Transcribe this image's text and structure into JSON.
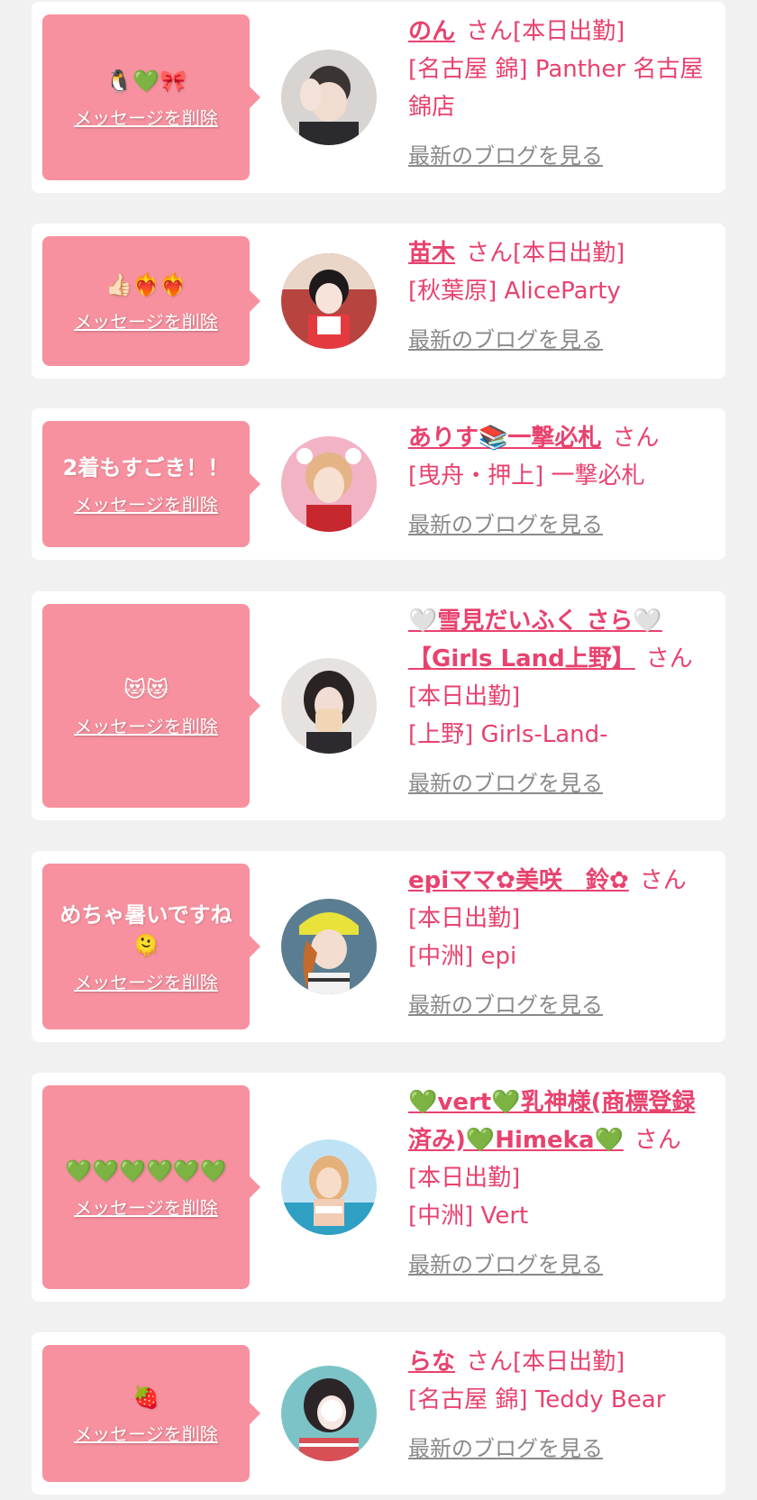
{
  "common": {
    "delete_label": "メッセージを削除",
    "blog_label": "最新のブログを見る",
    "san": "さん"
  },
  "cards": [
    {
      "message": "🐧💚🎀",
      "name": "のん",
      "status": "[本日出勤]",
      "shop": "[名古屋 錦] Panther 名古屋錦店"
    },
    {
      "message": "👍🏻❤️‍🔥❤️‍🔥",
      "name": "苗木",
      "status": "[本日出勤]",
      "shop": "[秋葉原] AliceParty"
    },
    {
      "message": "2着もすごき！！",
      "name": "ありす📚一撃必札",
      "status": "",
      "shop": "[曳舟・押上] 一撃必札"
    },
    {
      "message": "😻😻",
      "name": "🤍雪見だいふく さら🤍【Girls Land上野】",
      "status": "[本日出勤]",
      "shop": "[上野] Girls-Land-"
    },
    {
      "message": "めちゃ暑いですね🫠",
      "name": "epiママ✿美咲　鈴✿",
      "status": "[本日出勤]",
      "shop": "[中洲] epi"
    },
    {
      "message": "💚💚💚💚💚💚",
      "name": "💚vert💚乳神様(商標登録済み)💚Himeka💚",
      "status": "[本日出勤]",
      "shop": "[中洲] Vert"
    },
    {
      "message": "🍓",
      "name": "らな",
      "status": "[本日出勤]",
      "shop": "[名古屋 錦] Teddy Bear"
    }
  ]
}
